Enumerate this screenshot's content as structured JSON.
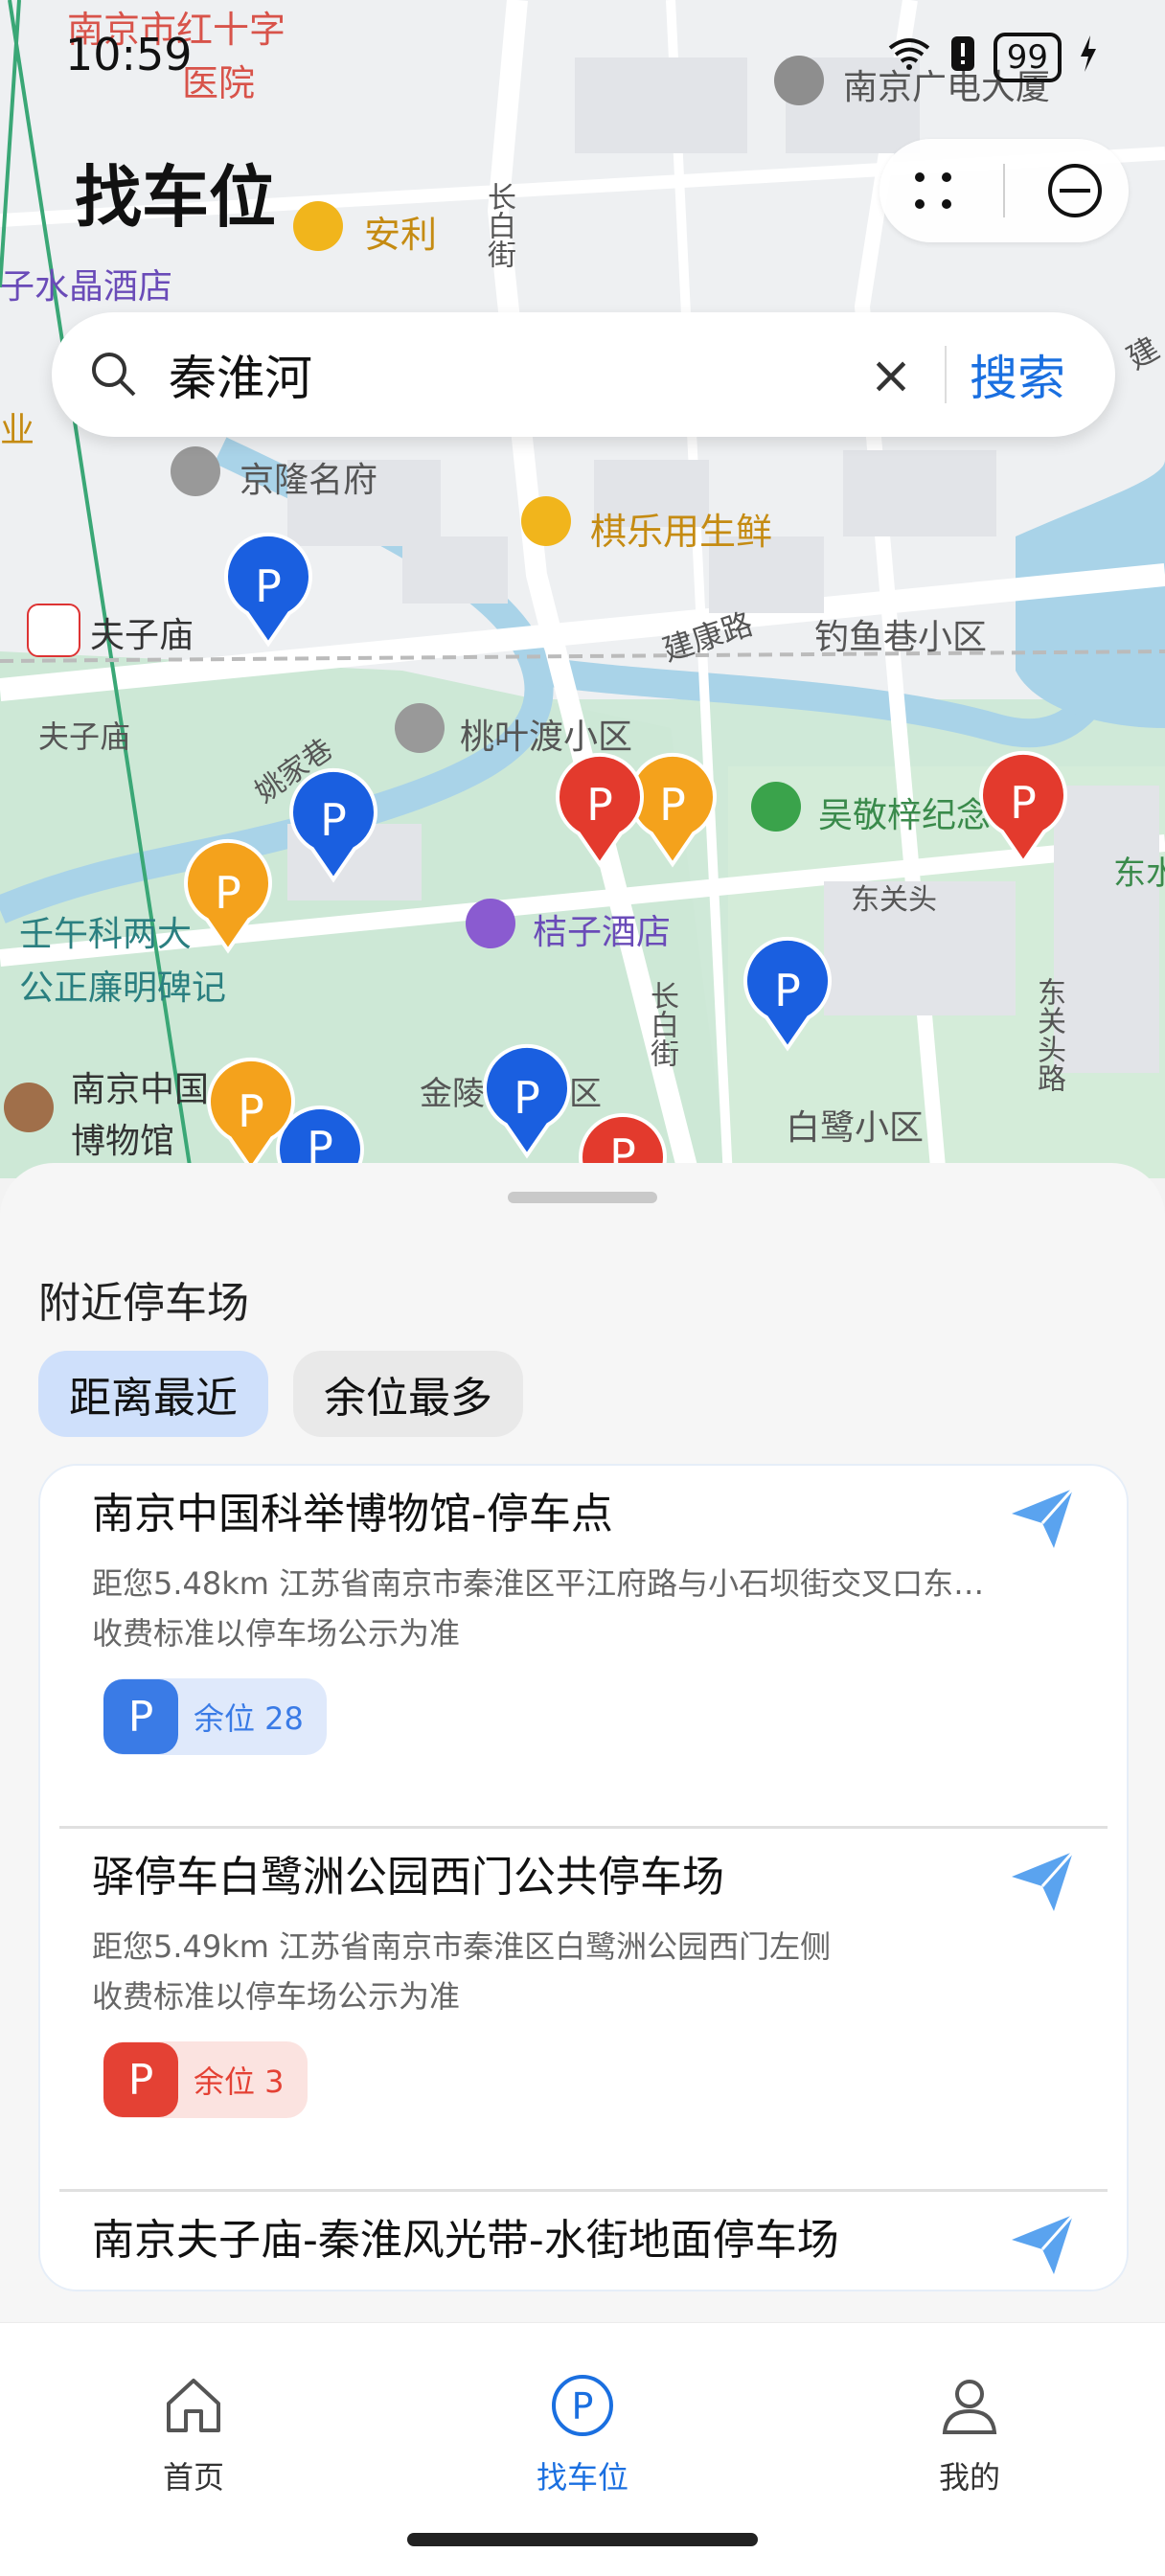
{
  "status_bar": {
    "time": "10:59",
    "battery": "99"
  },
  "page_title": "找车位",
  "search": {
    "value": "秦淮河",
    "clear_label": "×",
    "button": "搜索"
  },
  "map_labels": {
    "red_cross_hospital": "南京市红十字",
    "hospital": "医院",
    "nanjing_building": "南京广电大厦",
    "anli": "安利",
    "crystal_hotel": "子水晶酒店",
    "industry": "业",
    "jinglong": "京隆名府",
    "qile": "棋乐用生鲜",
    "fuzimiao_station": "夫子庙",
    "jiankang_road": "建康路",
    "diaoyuxiang": "钓鱼巷小区",
    "fuzimiao": "夫子庙",
    "taoyedu": "桃叶渡小区",
    "yaojiaxiang": "姚家巷",
    "wujingzi": "吴敬梓纪念",
    "dongguantou": "东关头",
    "dong": "东水",
    "renwu": "壬午科两大",
    "gongzheng": "公正廉明碑记",
    "juzi": "桔子酒店",
    "changbaijie_top": "长白街",
    "changbaijie": "长白街",
    "dongguantou_road": "东关头路",
    "museum": "南京中国",
    "museum2": "博物馆",
    "jinling": "金陵",
    "jinling_qu": "区",
    "bailu": "白鹭小区",
    "jian": "建"
  },
  "sheet": {
    "title": "附近停车场",
    "chips": [
      {
        "label": "距离最近",
        "active": true
      },
      {
        "label": "余位最多",
        "active": false
      }
    ],
    "items": [
      {
        "name": "南京中国科举博物馆-停车点",
        "address": "距您5.48km   江苏省南京市秦淮区平江府路与小石坝街交叉口东…",
        "fee": "收费标准以停车场公示为准",
        "badge_letter": "P",
        "spaces": "余位 28",
        "color": "#3a7be6",
        "badge_bg": "#dfe9fb"
      },
      {
        "name": "驿停车白鹭洲公园西门公共停车场",
        "address": "距您5.49km   江苏省南京市秦淮区白鹭洲公园西门左侧",
        "fee": "收费标准以停车场公示为准",
        "badge_letter": "P",
        "spaces": "余位 3",
        "color": "#e44134",
        "badge_bg": "#fbe3e0"
      },
      {
        "name": "南京夫子庙-秦淮风光带-水街地面停车场",
        "address": "",
        "fee": "",
        "badge_letter": "",
        "spaces": "",
        "color": "#3a7be6",
        "badge_bg": "#dfe9fb"
      }
    ]
  },
  "tabbar": {
    "tabs": [
      {
        "label": "首页",
        "icon": "home-icon",
        "active": false
      },
      {
        "label": "找车位",
        "icon": "parking-icon",
        "active": true
      },
      {
        "label": "我的",
        "icon": "person-icon",
        "active": false
      }
    ]
  },
  "colors": {
    "accent": "#1a6fe0",
    "pin_blue": "#1a5fe0",
    "pin_orange": "#f4a21c",
    "pin_red": "#e33a2d"
  }
}
